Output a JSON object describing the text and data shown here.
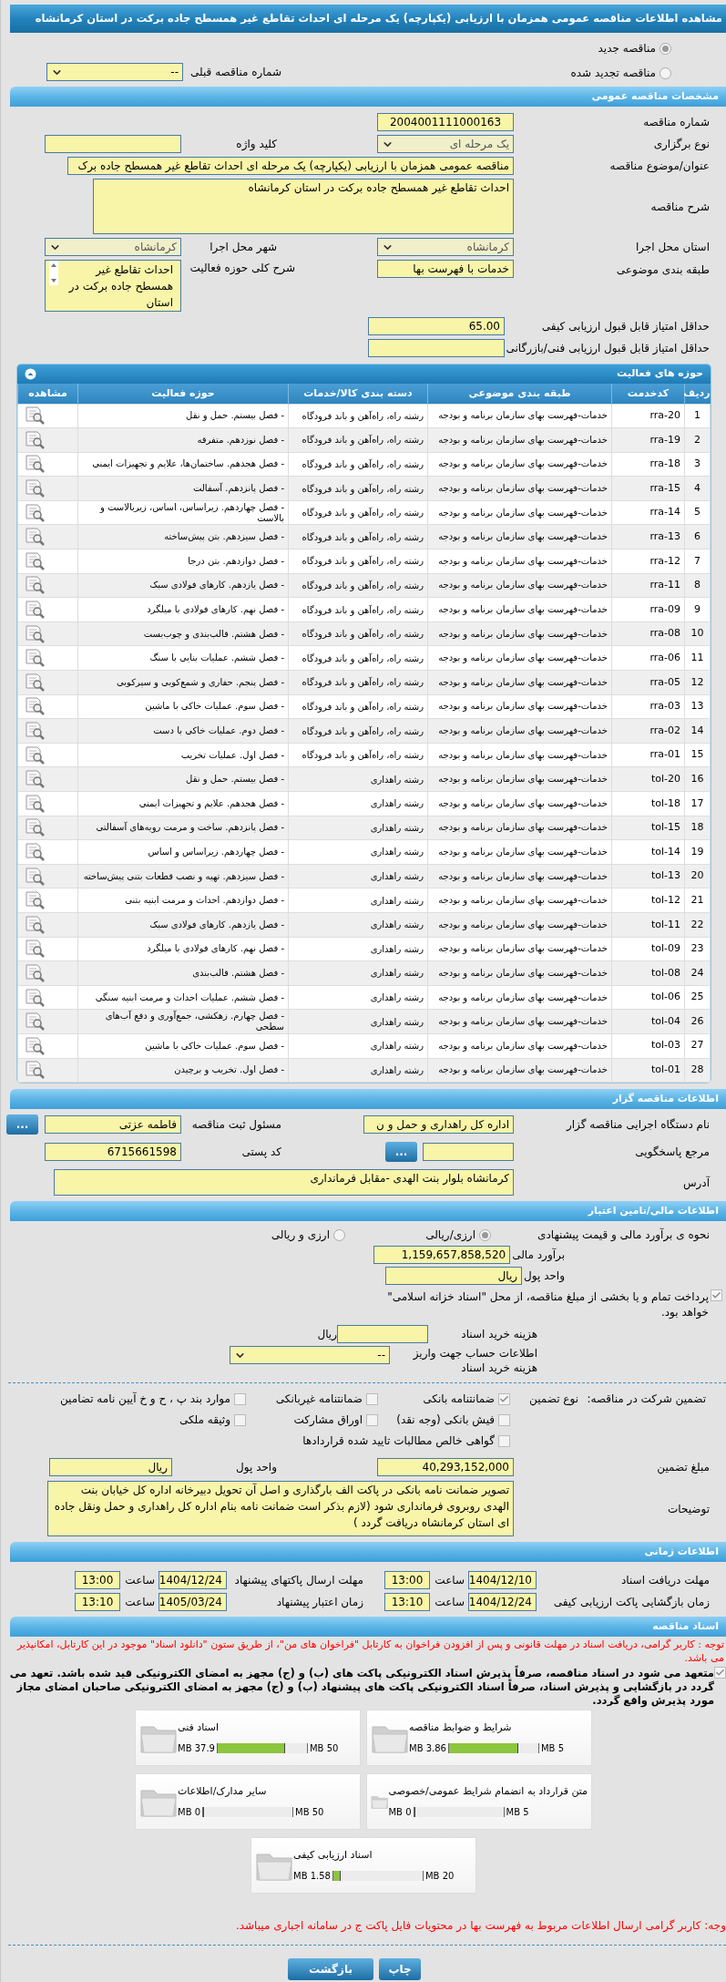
{
  "title": "مشاهده اطلاعات مناقصه عمومی همزمان با ارزیابی (یکپارچه) یک مرحله ای احداث تقاطع غیر همسطح جاده برکت در استان کرمانشاه",
  "tender_status": [
    {
      "label": "مناقصه جدید",
      "selected": true
    },
    {
      "label": "مناقصه تجدید شده",
      "selected": false
    }
  ],
  "previous_tender": {
    "label": "شماره مناقصه قبلی",
    "value": "--"
  },
  "general": {
    "header": "مشخصات مناقصه عمومی",
    "number": {
      "label": "شماره مناقصه",
      "value": "2004001111000163"
    },
    "holding_type": {
      "label": "نوع برگزاری",
      "value": "یک مرحله ای"
    },
    "keyword": {
      "label": "کلید واژه"
    },
    "subject": {
      "label": "عنوان/موضوع مناقصه",
      "value": "مناقصه عمومی همزمان با ارزیابی (یکپارچه) یک مرحله ای احداث تقاطع غیر همسطح جاده برک"
    },
    "description": {
      "label": "شرح مناقصه",
      "value": "احداث تقاطع غیر همسطح جاده برکت  در استان کرمانشاه"
    },
    "province": {
      "label": "استان محل اجرا",
      "value": "کرمانشاه"
    },
    "city": {
      "label": "شهر محل اجرا",
      "value": "کرمانشاه"
    },
    "classification": {
      "label": "طبقه بندی موضوعی",
      "value": "خدمات با فهرست بها"
    },
    "scope": {
      "label": "شرح کلی حوزه فعالیت",
      "value": "احداث تقاطع غیر همسطح جاده برکت  در استان"
    },
    "min_quality_score": {
      "label": "حداقل امتیاز قابل قبول ارزیابی کیفی",
      "value": "65.00"
    },
    "min_technical_score": {
      "label": "حداقل امتیاز قابل قبول ارزیابی فنی/بازرگانی"
    }
  },
  "activities": {
    "header": "حوزه های فعالیت",
    "columns": [
      "ردیف",
      "کدخدمت",
      "طبقه بندی موضوعی",
      "دسته بندی کالا/خدمات",
      "حوزه فعالیت",
      "مشاهده"
    ],
    "rows": [
      {
        "index": "1",
        "code": "rra-20",
        "category": "خدمات-فهرست بهای سازمان برنامه و بودجه",
        "group": "رشته راه، راه‌آهن و باند فرودگاه",
        "activity": "- فصل بیستم. حمل و نقل"
      },
      {
        "index": "2",
        "code": "rra-19",
        "category": "خدمات-فهرست بهای سازمان برنامه و بودجه",
        "group": "رشته راه، راه‌آهن و باند فرودگاه",
        "activity": "- فصل نوزدهم. متفرقه"
      },
      {
        "index": "3",
        "code": "rra-18",
        "category": "خدمات-فهرست بهای سازمان برنامه و بودجه",
        "group": "رشته راه، راه‌آهن و باند فرودگاه",
        "activity": "- فصل هجدهم. ساختمان‌ها، علایم و تجهیزات ایمنی"
      },
      {
        "index": "4",
        "code": "rra-15",
        "category": "خدمات-فهرست بهای سازمان برنامه و بودجه",
        "group": "رشته راه، راه‌آهن و باند فرودگاه",
        "activity": "- فصل پانزدهم. آسفالت"
      },
      {
        "index": "5",
        "code": "rra-14",
        "category": "خدمات-فهرست بهای سازمان برنامه و بودجه",
        "group": "رشته راه، راه‌آهن و باند فرودگاه",
        "activity": "- فصل چهاردهم. زیراساس، اساس، زیربالاست و بالاست"
      },
      {
        "index": "6",
        "code": "rra-13",
        "category": "خدمات-فهرست بهای سازمان برنامه و بودجه",
        "group": "رشته راه، راه‌آهن و باند فرودگاه",
        "activity": "- فصل سیزدهم. بتن پیش‌ساخته"
      },
      {
        "index": "7",
        "code": "rra-12",
        "category": "خدمات-فهرست بهای سازمان برنامه و بودجه",
        "group": "رشته راه، راه‌آهن و باند فرودگاه",
        "activity": "- فصل دوازدهم. بتن درجا"
      },
      {
        "index": "8",
        "code": "rra-11",
        "category": "خدمات-فهرست بهای سازمان برنامه و بودجه",
        "group": "رشته راه، راه‌آهن و باند فرودگاه",
        "activity": "- فصل یازدهم. کارهای فولادی سبک"
      },
      {
        "index": "9",
        "code": "rra-09",
        "category": "خدمات-فهرست بهای سازمان برنامه و بودجه",
        "group": "رشته راه، راه‌آهن و باند فرودگاه",
        "activity": "- فصل نهم. کارهای فولادی با میلگرد"
      },
      {
        "index": "10",
        "code": "rra-08",
        "category": "خدمات-فهرست بهای سازمان برنامه و بودجه",
        "group": "رشته راه، راه‌آهن و باند فرودگاه",
        "activity": "- فصل هشتم. قالب‌بندی و چوب‌بست"
      },
      {
        "index": "11",
        "code": "rra-06",
        "category": "خدمات-فهرست بهای سازمان برنامه و بودجه",
        "group": "رشته راه، راه‌آهن و باند فرودگاه",
        "activity": "- فصل ششم. عملیات بنایی با سنگ"
      },
      {
        "index": "12",
        "code": "rra-05",
        "category": "خدمات-فهرست بهای سازمان برنامه و بودجه",
        "group": "رشته راه، راه‌آهن و باند فرودگاه",
        "activity": "- فصل پنجم. حفاری و شمع‌کوبی و سپرکوبی"
      },
      {
        "index": "13",
        "code": "rra-03",
        "category": "خدمات-فهرست بهای سازمان برنامه و بودجه",
        "group": "رشته راه، راه‌آهن و باند فرودگاه",
        "activity": "- فصل سوم. عملیات خاکی با ماشین"
      },
      {
        "index": "14",
        "code": "rra-02",
        "category": "خدمات-فهرست بهای سازمان برنامه و بودجه",
        "group": "رشته راه، راه‌آهن و باند فرودگاه",
        "activity": "- فصل دوم. عملیات خاکی با دست"
      },
      {
        "index": "15",
        "code": "rra-01",
        "category": "خدمات-فهرست بهای سازمان برنامه و بودجه",
        "group": "رشته راه، راه‌آهن و باند فرودگاه",
        "activity": "- فصل اول. عملیات تخریب"
      },
      {
        "index": "16",
        "code": "tol-20",
        "category": "خدمات-فهرست بهای سازمان برنامه و بودجه",
        "group": "رشته راهداری",
        "activity": "- فصل بیستم. حمل و نقل"
      },
      {
        "index": "17",
        "code": "tol-18",
        "category": "خدمات-فهرست بهای سازمان برنامه و بودجه",
        "group": "رشته راهداری",
        "activity": "- فصل هجدهم. علایم و تجهیزات ایمنی"
      },
      {
        "index": "18",
        "code": "tol-15",
        "category": "خدمات-فهرست بهای سازمان برنامه و بودجه",
        "group": "رشته راهداری",
        "activity": "- فصل پانزدهم. ساخت و مرمت رویه‌های آسفالتی"
      },
      {
        "index": "19",
        "code": "tol-14",
        "category": "خدمات-فهرست بهای سازمان برنامه و بودجه",
        "group": "رشته راهداری",
        "activity": "- فصل چهاردهم. زیراساس و اساس"
      },
      {
        "index": "20",
        "code": "tol-13",
        "category": "خدمات-فهرست بهای سازمان برنامه و بودجه",
        "group": "رشته راهداری",
        "activity": "- فصل سیزدهم. تهیه و نصب قطعات بتنی پیش‌ساخته"
      },
      {
        "index": "21",
        "code": "tol-12",
        "category": "خدمات-فهرست بهای سازمان برنامه و بودجه",
        "group": "رشته راهداری",
        "activity": "- فصل دوازدهم. احداث و مرمت ابنیه بتنی"
      },
      {
        "index": "22",
        "code": "tol-11",
        "category": "خدمات-فهرست بهای سازمان برنامه و بودجه",
        "group": "رشته راهداری",
        "activity": "- فصل یازدهم. کارهای فولادی سبک"
      },
      {
        "index": "23",
        "code": "tol-09",
        "category": "خدمات-فهرست بهای سازمان برنامه و بودجه",
        "group": "رشته راهداری",
        "activity": "- فصل نهم. کارهای فولادی با میلگرد"
      },
      {
        "index": "24",
        "code": "tol-08",
        "category": "خدمات-فهرست بهای سازمان برنامه و بودجه",
        "group": "رشته راهداری",
        "activity": "- فصل هشتم. قالب‌بندی"
      },
      {
        "index": "25",
        "code": "tol-06",
        "category": "خدمات-فهرست بهای سازمان برنامه و بودجه",
        "group": "رشته راهداری",
        "activity": "- فصل ششم.  عملیات احداث و مرمت ابنیه سنگی"
      },
      {
        "index": "26",
        "code": "tol-04",
        "category": "خدمات-فهرست بهای سازمان برنامه و بودجه",
        "group": "رشته راهداری",
        "activity": "- فصل چهارم. زهکشی، جمع‌آوری و دفع آب‌های سطحی"
      },
      {
        "index": "27",
        "code": "tol-03",
        "category": "خدمات-فهرست بهای سازمان برنامه و بودجه",
        "group": "رشته راهداری",
        "activity": "- فصل سوم. عملیات خاکی با ماشین"
      },
      {
        "index": "28",
        "code": "tol-01",
        "category": "خدمات-فهرست بهای سازمان برنامه و بودجه",
        "group": "رشته راهداری",
        "activity": "- فصل اول. تخریب و برچیدن"
      }
    ]
  },
  "tenderer": {
    "header": "اطلاعات مناقصه گزار",
    "agency": {
      "label": "نام دستگاه اجرایی مناقصه گزار",
      "value": "اداره کل راهداری و حمل و ن"
    },
    "registrar": {
      "label": "مسئول ثبت مناقصه",
      "value": "فاطمه  عزتی",
      "button": "..."
    },
    "respondent": {
      "label": "مرجع پاسخگویی",
      "button": "..."
    },
    "postal_code": {
      "label": "کد پستی",
      "value": "6715661598"
    },
    "address": {
      "label": "آدرس",
      "value": "کرمانشاه بلوار بنت الهدی -مقابل فرمانداری"
    }
  },
  "finance": {
    "header": "اطلاعات مالی/تامین اعتبار",
    "estimate_method": {
      "label": "نحوه ی برآورد مالی و قیمت پیشنهادی",
      "options": [
        {
          "label": "ارزی/ریالی",
          "selected": true
        },
        {
          "label": "ارزی و ریالی",
          "selected": false
        }
      ]
    },
    "estimate": {
      "label": "برآورد مالی",
      "value": "1,159,657,858,520"
    },
    "currency": {
      "label": "واحد پول",
      "value": "ریال"
    },
    "treasury": {
      "label": "پرداخت تمام و یا بخشی از مبلغ مناقصه، از محل \"اسناد خزانه اسلامی\" خواهد بود.",
      "checked": true
    },
    "document_fee": {
      "label": "هزینه خرید اسناد",
      "unit": "ریال"
    },
    "fee_account": {
      "label": "اطلاعات حساب جهت واریز هزینه خرید اسناد",
      "value": "--"
    },
    "guarantee": {
      "label": "تضمین شرکت در مناقصه:",
      "type_label": "نوع تضمین",
      "options": [
        {
          "label": "ضمانتنامه بانکی",
          "checked": true
        },
        {
          "label": "ضمانتنامه غیربانکی",
          "checked": false
        },
        {
          "label": "موارد بند پ ، ح و خ آیین نامه تضامین",
          "checked": false
        },
        {
          "label": "فیش بانکی (وجه نقد)",
          "checked": false
        },
        {
          "label": "اوراق مشارکت",
          "checked": false
        },
        {
          "label": "وثیقه ملکی",
          "checked": false
        },
        {
          "label": "گواهی خالص مطالبات تایید شده قراردادها",
          "checked": false
        }
      ]
    },
    "guarantee_amount": {
      "label": "مبلغ تضمین",
      "value": "40,293,152,000"
    },
    "guarantee_currency": {
      "label": "واحد پول",
      "value": "ریال"
    },
    "notes": {
      "label": "توضیحات",
      "value": "تصویر ضمانت نامه بانکی در پاکت الف بارگذاری و اصل آن تحویل دبیرخانه اداره کل خیابان بنت الهدی روبروی فرمانداری شود  (لازم بذکر است ضمانت نامه بنام اداره کل راهداری و حمل ونقل جاده ای استان کرمانشاه دریافت گردد )"
    }
  },
  "schedule": {
    "header": "اطلاعات زمانی",
    "items": [
      {
        "label": "مهلت دریافت اسناد",
        "date": "1404/12/10",
        "time_label": "ساعت",
        "time": "13:00"
      },
      {
        "label": "مهلت ارسال پاکتهای پیشنهاد",
        "date": "1404/12/24",
        "time_label": "ساعت",
        "time": "13:00"
      },
      {
        "label": "زمان بازگشایی پاکت ارزیابی کیفی",
        "date": "1404/12/24",
        "time_label": "ساعت",
        "time": "13:10"
      },
      {
        "label": "زمان اعتبار پیشنهاد",
        "date": "1405/03/24",
        "time_label": "ساعت",
        "time": "13:10"
      }
    ]
  },
  "documents": {
    "header": "اسناد مناقصه",
    "notice": "توجه : کاربر گرامی، دریافت اسناد در مهلت قانونی و پس از افزودن فراخوان به کارتابل \"فراخوان های من\"، از طریق ستون \"دانلود اسناد\" موجود در این کارتابل، امکانپذیر می باشد.",
    "commitment": {
      "text": "متعهد می شود در اسناد مناقصه، صرفاً پذیرش اسناد الکترونیکی پاکت های (ب) و (ج) مجهز به امضای الکترونیکی قید شده باشد. تعهد می گردد در بازگشایی و پذیرش اسناد، صرفاً اسناد الکترونیکی پاکت های پیشنهاد (ب) و (ج) مجهز به امضای الکترونیکی صاحبان امضای مجاز مورد پذیرش واقع گردد.",
      "checked": true
    },
    "files": [
      {
        "title": "شرایط و ضوابط مناقصه",
        "limit": "5 MB",
        "size": "3.86 MB",
        "level": 0.772
      },
      {
        "title": "اسناد فنی",
        "limit": "50 MB",
        "size": "37.9 MB",
        "level": 0.758
      },
      {
        "title": "متن قرارداد به انضمام شرایط عمومی/خصوصی",
        "limit": "5 MB",
        "size": "0 MB",
        "level": 0
      },
      {
        "title": "سایر مدارک/اطلاعات",
        "limit": "50 MB",
        "size": "0 MB",
        "level": 0
      },
      {
        "title": "اسناد ارزیابی کیفی",
        "limit": "20 MB",
        "size": "1.58 MB",
        "level": 0.079
      }
    ],
    "footer_notice": "وجه: کاربر گرامی ارسال اطلاعات مربوط به فهرست بها در محتویات فایل پاکت ج در سامانه اجباری میباشد."
  },
  "buttons": [
    {
      "label": "چاپ"
    },
    {
      "label": "بازگشت"
    }
  ]
}
